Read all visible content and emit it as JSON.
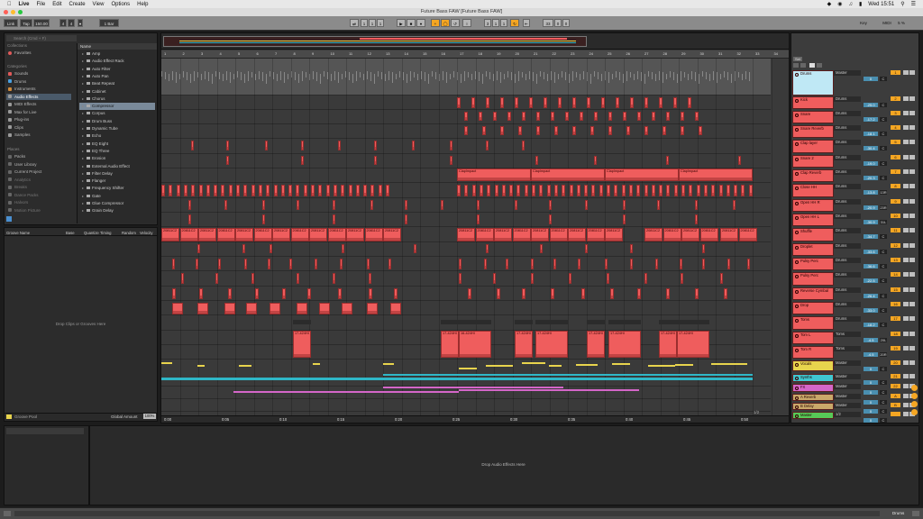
{
  "menubar": {
    "items": [
      "Live",
      "File",
      "Edit",
      "Create",
      "View",
      "Options",
      "Help"
    ],
    "clock": "Wed 15:51"
  },
  "window": {
    "title": "Future Bass FAW  [Future Bass FAW]"
  },
  "control": {
    "link": "Link",
    "tap": "Tap",
    "tempo": "150.00",
    "sig_n": "4",
    "sig_d": "4",
    "quant": "1 Bar",
    "pos1": "1",
    "pos2": "1",
    "pos3": "1",
    "loop1": "3",
    "loop2": "1",
    "loop3": "1",
    "len1": "33",
    "len2": "0",
    "len3": "0",
    "key": "Key",
    "midi": "MIDI",
    "cpu": "5 %"
  },
  "browser": {
    "search": "Search (Cmd + F)",
    "collections_label": "Collections",
    "favorites": "Favorites",
    "categories_label": "Categories",
    "categories": [
      {
        "label": "Sounds",
        "color": "#e05a5a"
      },
      {
        "label": "Drums",
        "color": "#4aa0e0"
      },
      {
        "label": "Instruments",
        "color": "#d08a3a"
      },
      {
        "label": "Audio Effects",
        "color": "#9a9a9a"
      },
      {
        "label": "MIDI Effects",
        "color": "#9a9a9a"
      },
      {
        "label": "Max for Live",
        "color": "#9a9a9a"
      },
      {
        "label": "Plug-ins",
        "color": "#9a9a9a"
      },
      {
        "label": "Clips",
        "color": "#9a9a9a"
      },
      {
        "label": "Samples",
        "color": "#9a9a9a"
      }
    ],
    "places_label": "Places",
    "places": [
      "Packs",
      "User Library",
      "Current Project",
      "Analytics",
      "Breaks",
      "Dance Packs",
      "Halvors",
      "Motion Picture"
    ],
    "names_header": "Name",
    "names": [
      "Amp",
      "Audio Effect Rack",
      "Auto Filter",
      "Auto Pan",
      "Beat Repeat",
      "Cabinet",
      "Chorus",
      "Compressor",
      "Corpus",
      "Drum Buss",
      "Dynamic Tube",
      "Echo",
      "EQ Eight",
      "EQ Three",
      "Erosion",
      "External Audio Effect",
      "Filter Delay",
      "Flanger",
      "Frequency Shifter",
      "Gate",
      "Glue Compressor",
      "Grain Delay"
    ],
    "selected": "Compressor"
  },
  "groove": {
    "cols": [
      "Groove Name",
      "Base",
      "Quantize",
      "Timing",
      "Random",
      "Velocity"
    ],
    "drop": "Drop Clips or Grooves Here",
    "pool": "Groove Pool",
    "global": "Global Amount",
    "global_val": "100%"
  },
  "arrangement": {
    "bars": [
      "1",
      "2",
      "3",
      "4",
      "5",
      "6",
      "7",
      "8",
      "9",
      "10",
      "11",
      "12",
      "13",
      "14",
      "15",
      "16",
      "17",
      "18",
      "19",
      "20",
      "21",
      "22",
      "23",
      "24",
      "25",
      "26",
      "27",
      "28",
      "29",
      "30",
      "31",
      "32",
      "33",
      "34"
    ],
    "times": [
      "0:00",
      "0:05",
      "0:10",
      "0:15",
      "0:20",
      "0:25",
      "0:30",
      "0:35",
      "0:40",
      "0:45",
      "0:50"
    ],
    "clap_label": "ClapImpact",
    "loop_label": "20811C2",
    "tom_label": "17-424HI",
    "tom2_label": "16-424HI",
    "zoom": "1/2"
  },
  "mixer": {
    "set": "Set",
    "tracks": [
      {
        "name": "Drums",
        "route": "Master",
        "vol": "0",
        "pan": "C",
        "num": "1",
        "color": "#bfe8f5"
      },
      {
        "name": "Kick",
        "route": "Drums",
        "vol": "-25.0",
        "pan": "C",
        "num": "2",
        "color": "#ef5d5d"
      },
      {
        "name": "Snare",
        "route": "Drums",
        "vol": "-17.2",
        "pan": "C",
        "num": "3",
        "color": "#ef5d5d"
      },
      {
        "name": "Snare Reverb",
        "route": "Drums",
        "vol": "-18.1",
        "pan": "C",
        "num": "4",
        "color": "#ef5d5d"
      },
      {
        "name": "Clap layer",
        "route": "Drums",
        "vol": "-30.4",
        "pan": "C",
        "num": "5",
        "color": "#ef5d5d"
      },
      {
        "name": "Snare 2",
        "route": "Drums",
        "vol": "-19.0",
        "pan": "C",
        "num": "6",
        "color": "#ef5d5d"
      },
      {
        "name": "Clap Reverb",
        "route": "Drums",
        "vol": "-20.3",
        "pan": "C",
        "num": "7",
        "color": "#ef5d5d"
      },
      {
        "name": "Close HH",
        "route": "Drums",
        "vol": "-13.8",
        "pan": "13R",
        "num": "8",
        "color": "#ef5d5d"
      },
      {
        "name": "Open HH R",
        "route": "Drums",
        "vol": "-20.9",
        "pan": "23R",
        "num": "9",
        "color": "#ef5d5d"
      },
      {
        "name": "Open HH L",
        "route": "Drums",
        "vol": "-30.9",
        "pan": "31L",
        "num": "10",
        "color": "#ef5d5d"
      },
      {
        "name": "Shuffle",
        "route": "Drums",
        "vol": "-34.7",
        "pan": "C",
        "num": "11",
        "color": "#ef5d5d"
      },
      {
        "name": "Droplet",
        "route": "Drums",
        "vol": "-33.6",
        "pan": "C",
        "num": "12",
        "color": "#ef5d5d"
      },
      {
        "name": "Pulsy Perc",
        "route": "Drums",
        "vol": "-36.6",
        "pan": "C",
        "num": "13",
        "color": "#ef5d5d"
      },
      {
        "name": "Pulsy Perc",
        "route": "Drums",
        "vol": "-22.5",
        "pan": "C",
        "num": "14",
        "color": "#ef5d5d"
      },
      {
        "name": "Reverse Cymbal",
        "route": "Drums",
        "vol": "-26.4",
        "pan": "C",
        "num": "15",
        "color": "#ef5d5d"
      },
      {
        "name": "Drop",
        "route": "Drums",
        "vol": "-33.0",
        "pan": "C",
        "num": "16",
        "color": "#ef5d5d"
      },
      {
        "name": "Toms",
        "route": "Drums",
        "vol": "-18.2",
        "pan": "C",
        "num": "17",
        "color": "#ef5d5d"
      },
      {
        "name": "Tom L",
        "route": "Toms",
        "vol": "-4.5",
        "pan": "20L",
        "num": "18",
        "color": "#ef5d5d"
      },
      {
        "name": "Tom R",
        "route": "Toms",
        "vol": "-4.5",
        "pan": "20R",
        "num": "19",
        "color": "#ef5d5d"
      },
      {
        "name": "Vocals",
        "route": "Master",
        "vol": "0",
        "pan": "C",
        "num": "20",
        "color": "#e8d44d"
      },
      {
        "name": "Synths",
        "route": "Master",
        "vol": "0",
        "pan": "C",
        "num": "21",
        "color": "#3fc7d0"
      },
      {
        "name": "FX",
        "route": "Master",
        "vol": "0",
        "pan": "C",
        "num": "22",
        "color": "#d466c8"
      },
      {
        "name": "A Reverb",
        "route": "Master",
        "vol": "0",
        "pan": "C",
        "num": "A",
        "color": "#c9a86a"
      },
      {
        "name": "B Delay",
        "route": "Master",
        "vol": "0",
        "pan": "C",
        "num": "B",
        "color": "#c9a86a"
      },
      {
        "name": "Master",
        "route": "1/2",
        "vol": "0",
        "pan": "C",
        "num": "",
        "color": "#57c957"
      }
    ]
  },
  "detail": {
    "drop": "Drop Audio Effects Here"
  },
  "status": {
    "track": "Drums"
  }
}
